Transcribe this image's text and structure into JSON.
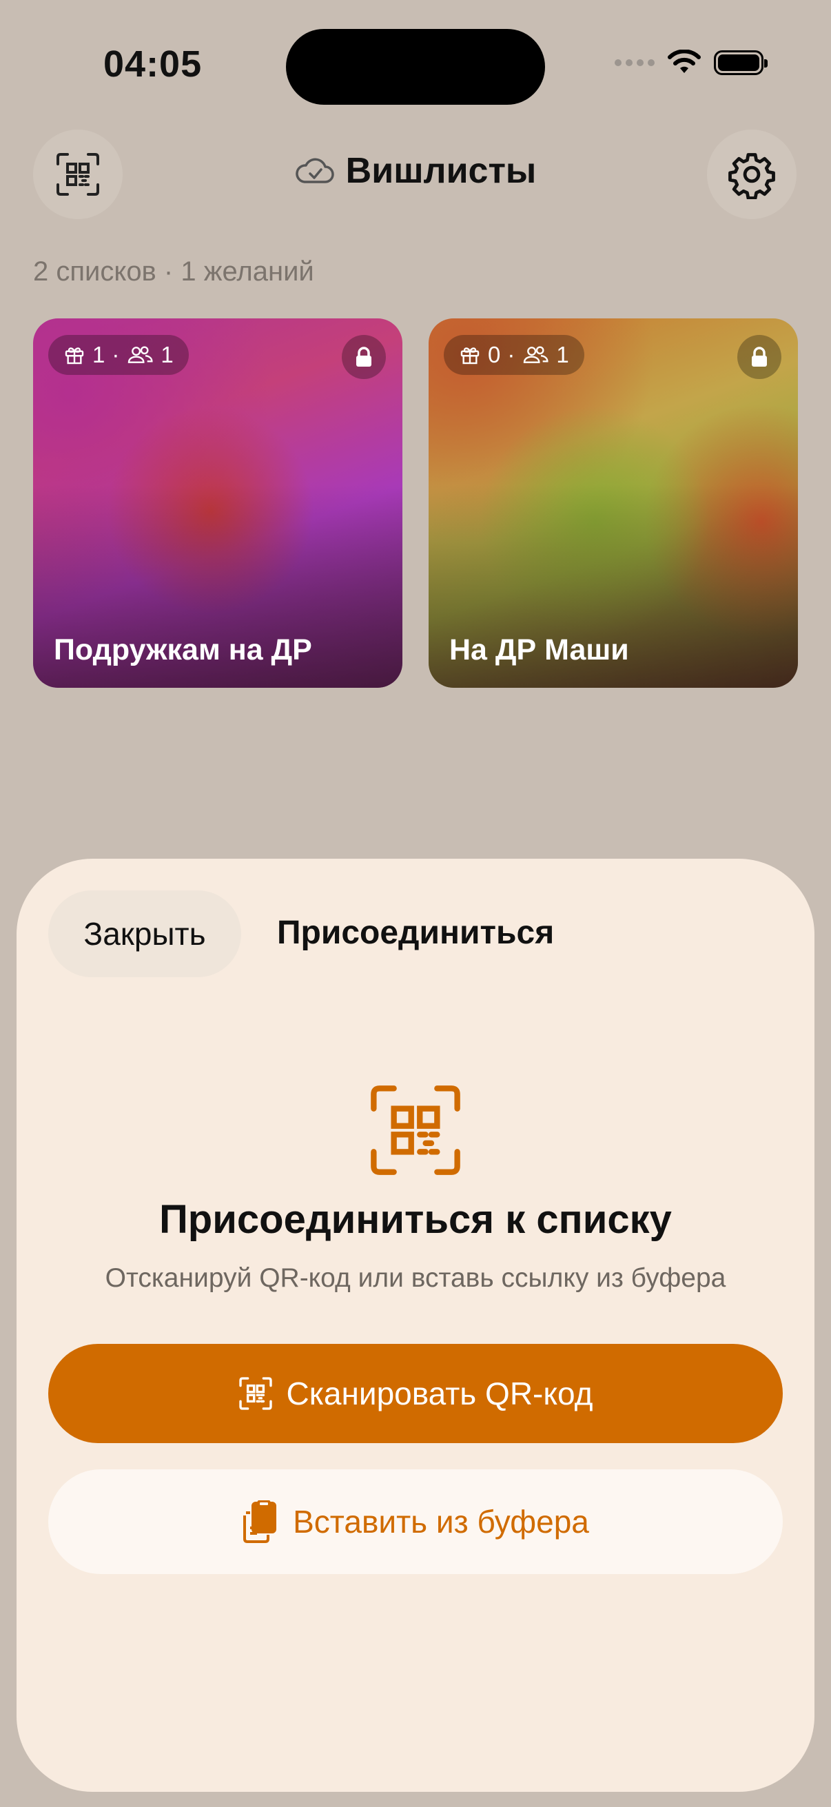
{
  "status_bar": {
    "time": "04:05"
  },
  "header": {
    "title": "Вишлисты"
  },
  "summary": "2 списков · 1 желаний",
  "lists": [
    {
      "gifts": "1",
      "separator": "·",
      "members": "1",
      "title": "Подружкам на ДР"
    },
    {
      "gifts": "0",
      "separator": "·",
      "members": "1",
      "title": "На ДР Маши"
    }
  ],
  "sheet": {
    "close_label": "Закрыть",
    "title": "Присоединиться",
    "heading": "Присоединиться к списку",
    "subtitle": "Отсканируй QR-код или вставь ссылку из буфера",
    "scan_label": "Сканировать QR-код",
    "paste_label": "Вставить из буфера"
  },
  "colors": {
    "accent": "#d06b00",
    "sheet_bg": "#f8ebdf",
    "background": "#c8bdb3"
  }
}
